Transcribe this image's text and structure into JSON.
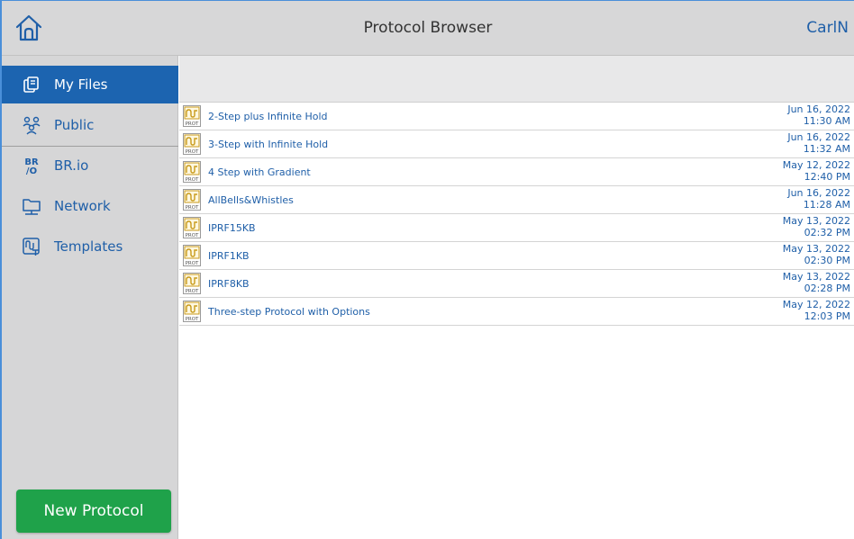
{
  "header": {
    "title": "Protocol Browser",
    "user": "CarlN"
  },
  "sidebar": {
    "items": [
      {
        "label": "My Files",
        "icon": "my-files-icon",
        "active": true
      },
      {
        "label": "Public",
        "icon": "public-users-icon",
        "active": false
      },
      {
        "label": "BR.io",
        "icon": "brio-icon",
        "active": false
      },
      {
        "label": "Network",
        "icon": "network-folder-icon",
        "active": false
      },
      {
        "label": "Templates",
        "icon": "templates-icon",
        "active": false
      }
    ],
    "new_protocol_label": "New Protocol"
  },
  "files": [
    {
      "name": "2-Step plus Infinite Hold",
      "date": "Jun 16, 2022",
      "time": "11:30 AM"
    },
    {
      "name": "3-Step with Infinite Hold",
      "date": "Jun 16, 2022",
      "time": "11:32 AM"
    },
    {
      "name": "4 Step with Gradient",
      "date": "May 12, 2022",
      "time": "12:40 PM"
    },
    {
      "name": "AllBells&Whistles",
      "date": "Jun 16, 2022",
      "time": "11:28 AM"
    },
    {
      "name": "IPRF15KB",
      "date": "May 13, 2022",
      "time": "02:32 PM"
    },
    {
      "name": "IPRF1KB",
      "date": "May 13, 2022",
      "time": "02:30 PM"
    },
    {
      "name": "IPRF8KB",
      "date": "May 13, 2022",
      "time": "02:28 PM"
    },
    {
      "name": "Three-step Protocol with Options",
      "date": "May 12, 2022",
      "time": "12:03 PM"
    }
  ],
  "file_icon_label": "PROT",
  "colors": {
    "accent": "#1c64b0",
    "text_link": "#1f5fa8",
    "primary_button": "#1fa24a",
    "header_bg": "#d7d7d8",
    "sidebar_bg": "#d6d6d7",
    "icon_gold": "#c89a1a"
  }
}
